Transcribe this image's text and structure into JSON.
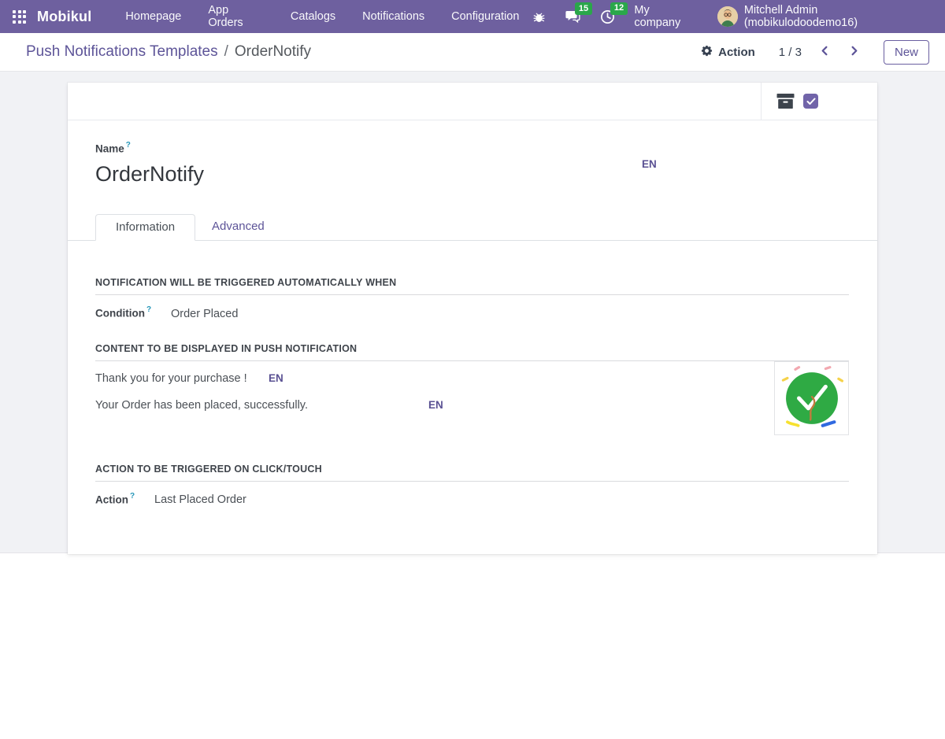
{
  "navbar": {
    "brand": "Mobikul",
    "menu_items": [
      "Homepage",
      "App Orders",
      "Catalogs",
      "Notifications",
      "Configuration"
    ],
    "systray": {
      "message_count": "15",
      "activity_count": "12",
      "company": "My company",
      "user": "Mitchell Admin (mobikulodoodemo16)"
    }
  },
  "control_panel": {
    "breadcrumb_parent": "Push Notifications Templates",
    "breadcrumb_separator": "/",
    "breadcrumb_current": "OrderNotify",
    "action_label": "Action",
    "pager": "1 / 3",
    "new_button": "New"
  },
  "form": {
    "name_label": "Name",
    "name_help": "?",
    "name_value": "OrderNotify",
    "name_lang": "EN",
    "tabs": [
      "Information",
      "Advanced"
    ],
    "trigger_section": {
      "title": "NOTIFICATION WILL BE TRIGGERED AUTOMATICALLY WHEN",
      "condition_label": "Condition",
      "condition_help": "?",
      "condition_value": "Order Placed"
    },
    "content_section": {
      "title": "CONTENT TO BE DISPLAYED IN PUSH NOTIFICATION",
      "rows": [
        {
          "text": "Thank you for your purchase !",
          "lang": "EN"
        },
        {
          "text": "Your Order has been placed, successfully.",
          "lang": "EN"
        }
      ]
    },
    "action_section": {
      "title": "ACTION TO BE TRIGGERED ON CLICK/TOUCH",
      "action_label": "Action",
      "action_help": "?",
      "action_value": "Last Placed Order"
    }
  },
  "icons": {
    "apps_grid": "3x3-dot-grid",
    "bug": "bug-glyph",
    "messages": "chat-bubbles",
    "activities": "clock",
    "gear": "gear",
    "chevron_left": "chevron-left",
    "chevron_right": "chevron-right",
    "archive_box": "archive-box",
    "checkbox": "checked-checkbox",
    "success_image": "green-circle-checkmark-confetti"
  },
  "colors": {
    "navbar_bg": "#6e609f",
    "badge_green": "#2aa74a",
    "accent_purple": "#5d5498",
    "checkbox_purple": "#7164a9",
    "success_green": "#2faa44",
    "content_bg": "#f1f2f5",
    "help_teal": "#2596b8"
  }
}
